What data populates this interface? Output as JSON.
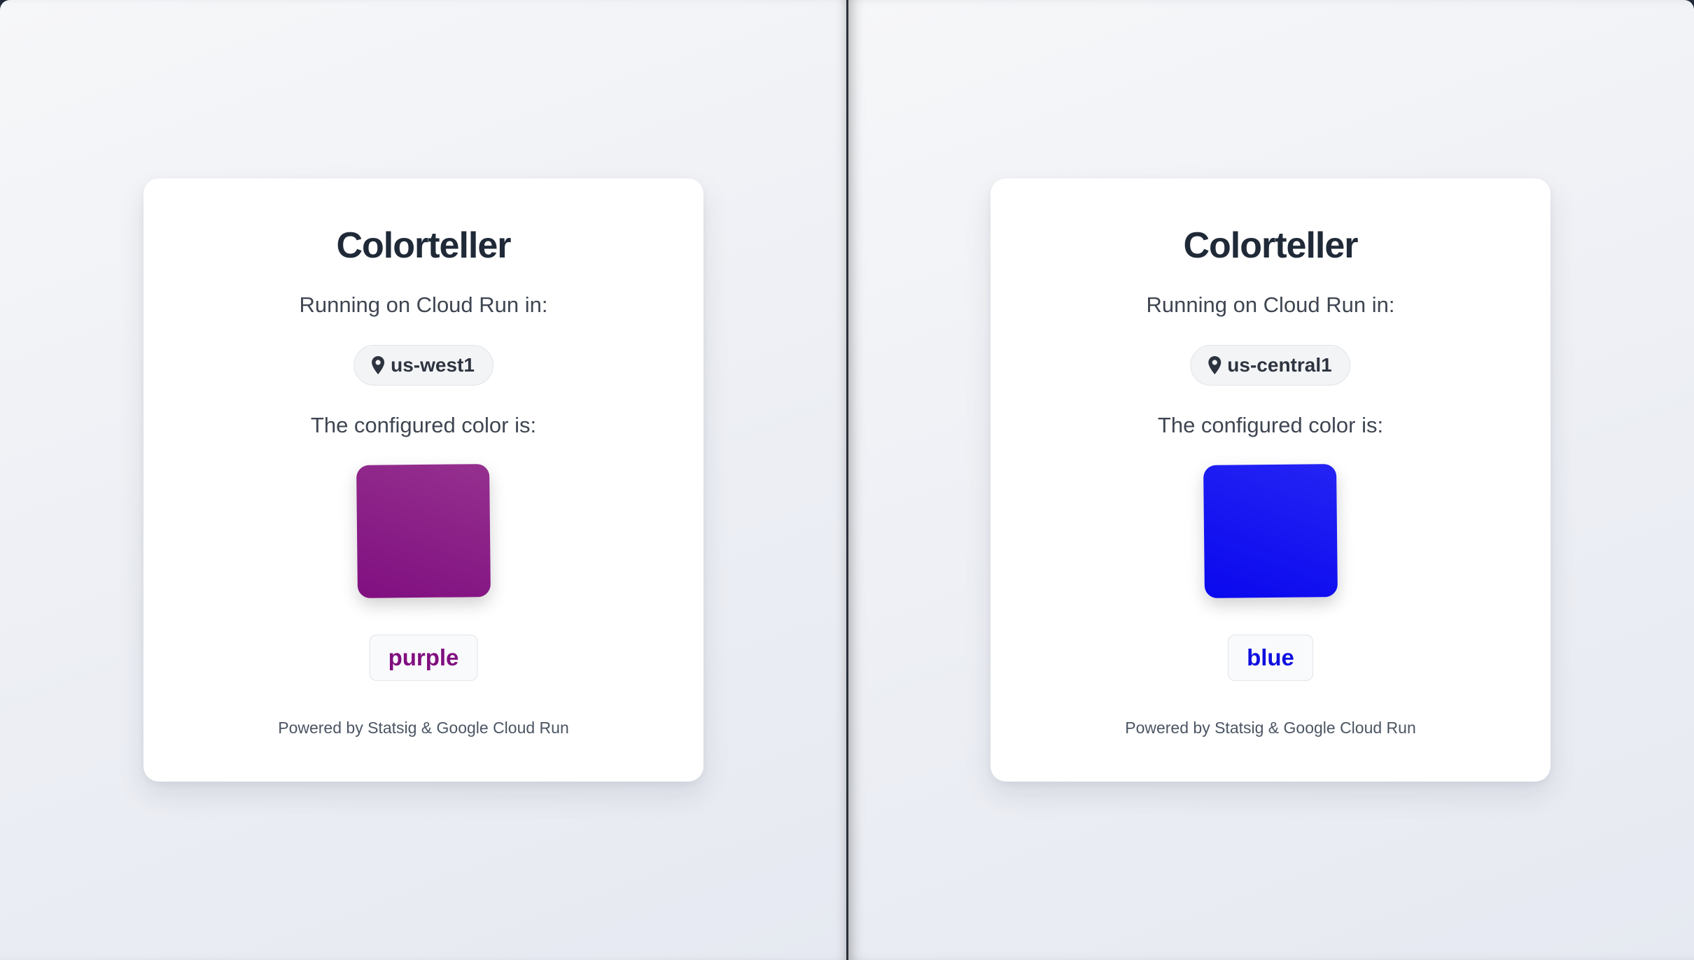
{
  "panels": [
    {
      "title": "Colorteller",
      "running_label": "Running on Cloud Run in:",
      "region": "us-west1",
      "configured_label": "The configured color is:",
      "color_name": "purple",
      "color_hex": "#8b1a8a",
      "footer": "Powered by Statsig & Google Cloud Run",
      "icon": "map-pin-icon"
    },
    {
      "title": "Colorteller",
      "running_label": "Running on Cloud Run in:",
      "region": "us-central1",
      "configured_label": "The configured color is:",
      "color_name": "blue",
      "color_hex": "#1010f2",
      "footer": "Powered by Statsig & Google Cloud Run",
      "icon": "map-pin-icon"
    }
  ],
  "colors": {
    "purple_gradient": [
      "#95308f",
      "#800f80"
    ],
    "blue_gradient": [
      "#2424f4",
      "#0a08ee"
    ],
    "text_dark": "#1f2937",
    "text_muted": "#3f4652"
  }
}
